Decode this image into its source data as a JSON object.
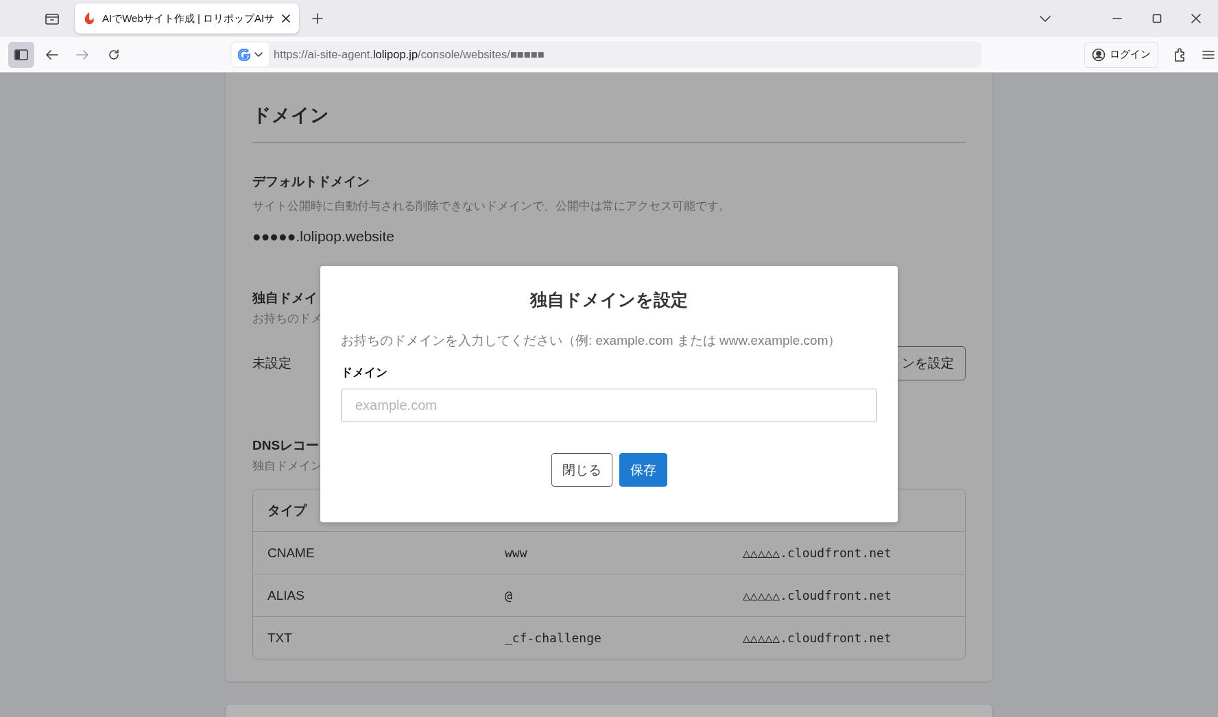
{
  "browser": {
    "tabs": [
      {
        "title": "AIでWebサイト作成 | ロリポップAIサ",
        "selected": true
      }
    ],
    "url": {
      "prefix": "https://ai-site-agent.",
      "host": "lolipop.jp",
      "path": "/console/websites/■■■■■"
    },
    "login_button": "ログイン"
  },
  "page": {
    "title": "ドメイン",
    "default_domain": {
      "heading": "デフォルトドメイン",
      "description": "サイト公開時に自動付与される削除できないドメインで、公開中は常にアクセス可能です。",
      "value": "●●●●●.lolipop.website"
    },
    "custom_domain": {
      "heading": "独自ドメイ",
      "description": "お持ちのドメ",
      "status": "未設定",
      "button": "ンを設定"
    },
    "dns_records": {
      "heading": "DNSレコー",
      "description": "独自ドメイン",
      "columns": [
        "タイプ"
      ],
      "rows": [
        {
          "type": "CNAME",
          "name": "www",
          "value": "△△△△△.cloudfront.net"
        },
        {
          "type": "ALIAS",
          "name": "@",
          "value": "△△△△△.cloudfront.net"
        },
        {
          "type": "TXT",
          "name": "_cf-challenge",
          "value": "△△△△△.cloudfront.net"
        }
      ]
    }
  },
  "modal": {
    "title": "独自ドメインを設定",
    "description": "お持ちのドメインを入力してください（例: example.com または www.example.com）",
    "field_label": "ドメイン",
    "placeholder": "example.com",
    "buttons": [
      {
        "label": "閉じる",
        "kind": "secondary"
      },
      {
        "label": "保存",
        "kind": "primary"
      }
    ]
  }
}
